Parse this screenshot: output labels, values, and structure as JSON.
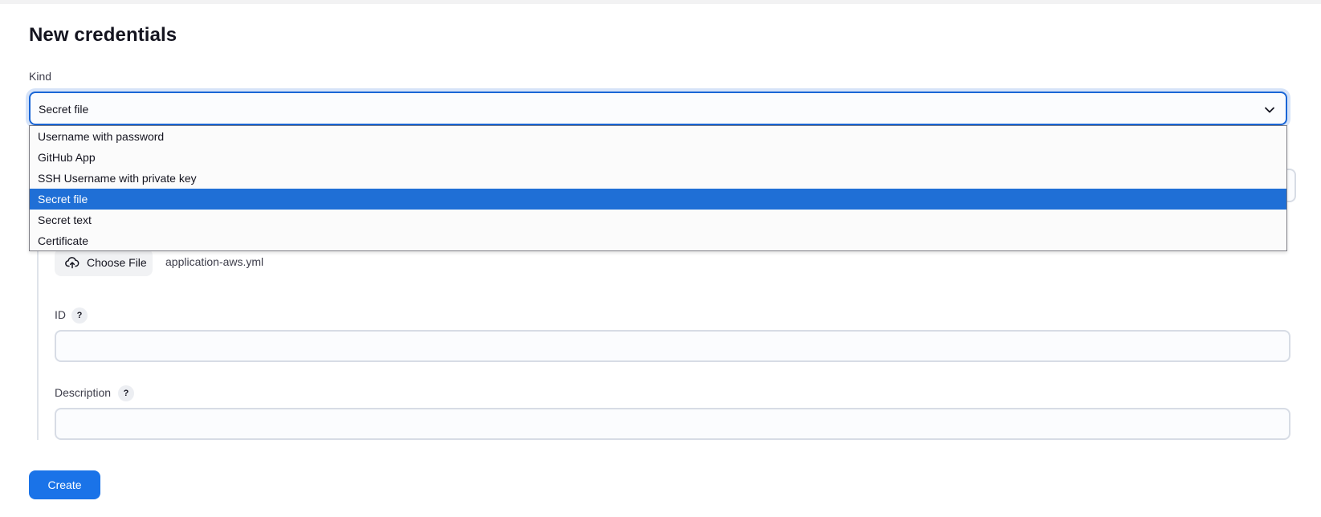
{
  "page": {
    "title": "New credentials"
  },
  "kind": {
    "label": "Kind",
    "selected": "Secret file",
    "options": [
      "Username with password",
      "GitHub App",
      "SSH Username with private key",
      "Secret file",
      "Secret text",
      "Certificate"
    ],
    "selected_index": 3
  },
  "file": {
    "button_label": "Choose File",
    "file_name": "application-aws.yml",
    "icon": "cloud-upload-icon"
  },
  "id_field": {
    "label": "ID",
    "help": "?",
    "value": "",
    "placeholder": ""
  },
  "description_field": {
    "label": "Description",
    "help": "?",
    "value": "",
    "placeholder": ""
  },
  "actions": {
    "create_label": "Create"
  },
  "colors": {
    "accent": "#1a73e8",
    "selected_option": "#1f6fd6",
    "focus_border": "#1a66d6"
  }
}
